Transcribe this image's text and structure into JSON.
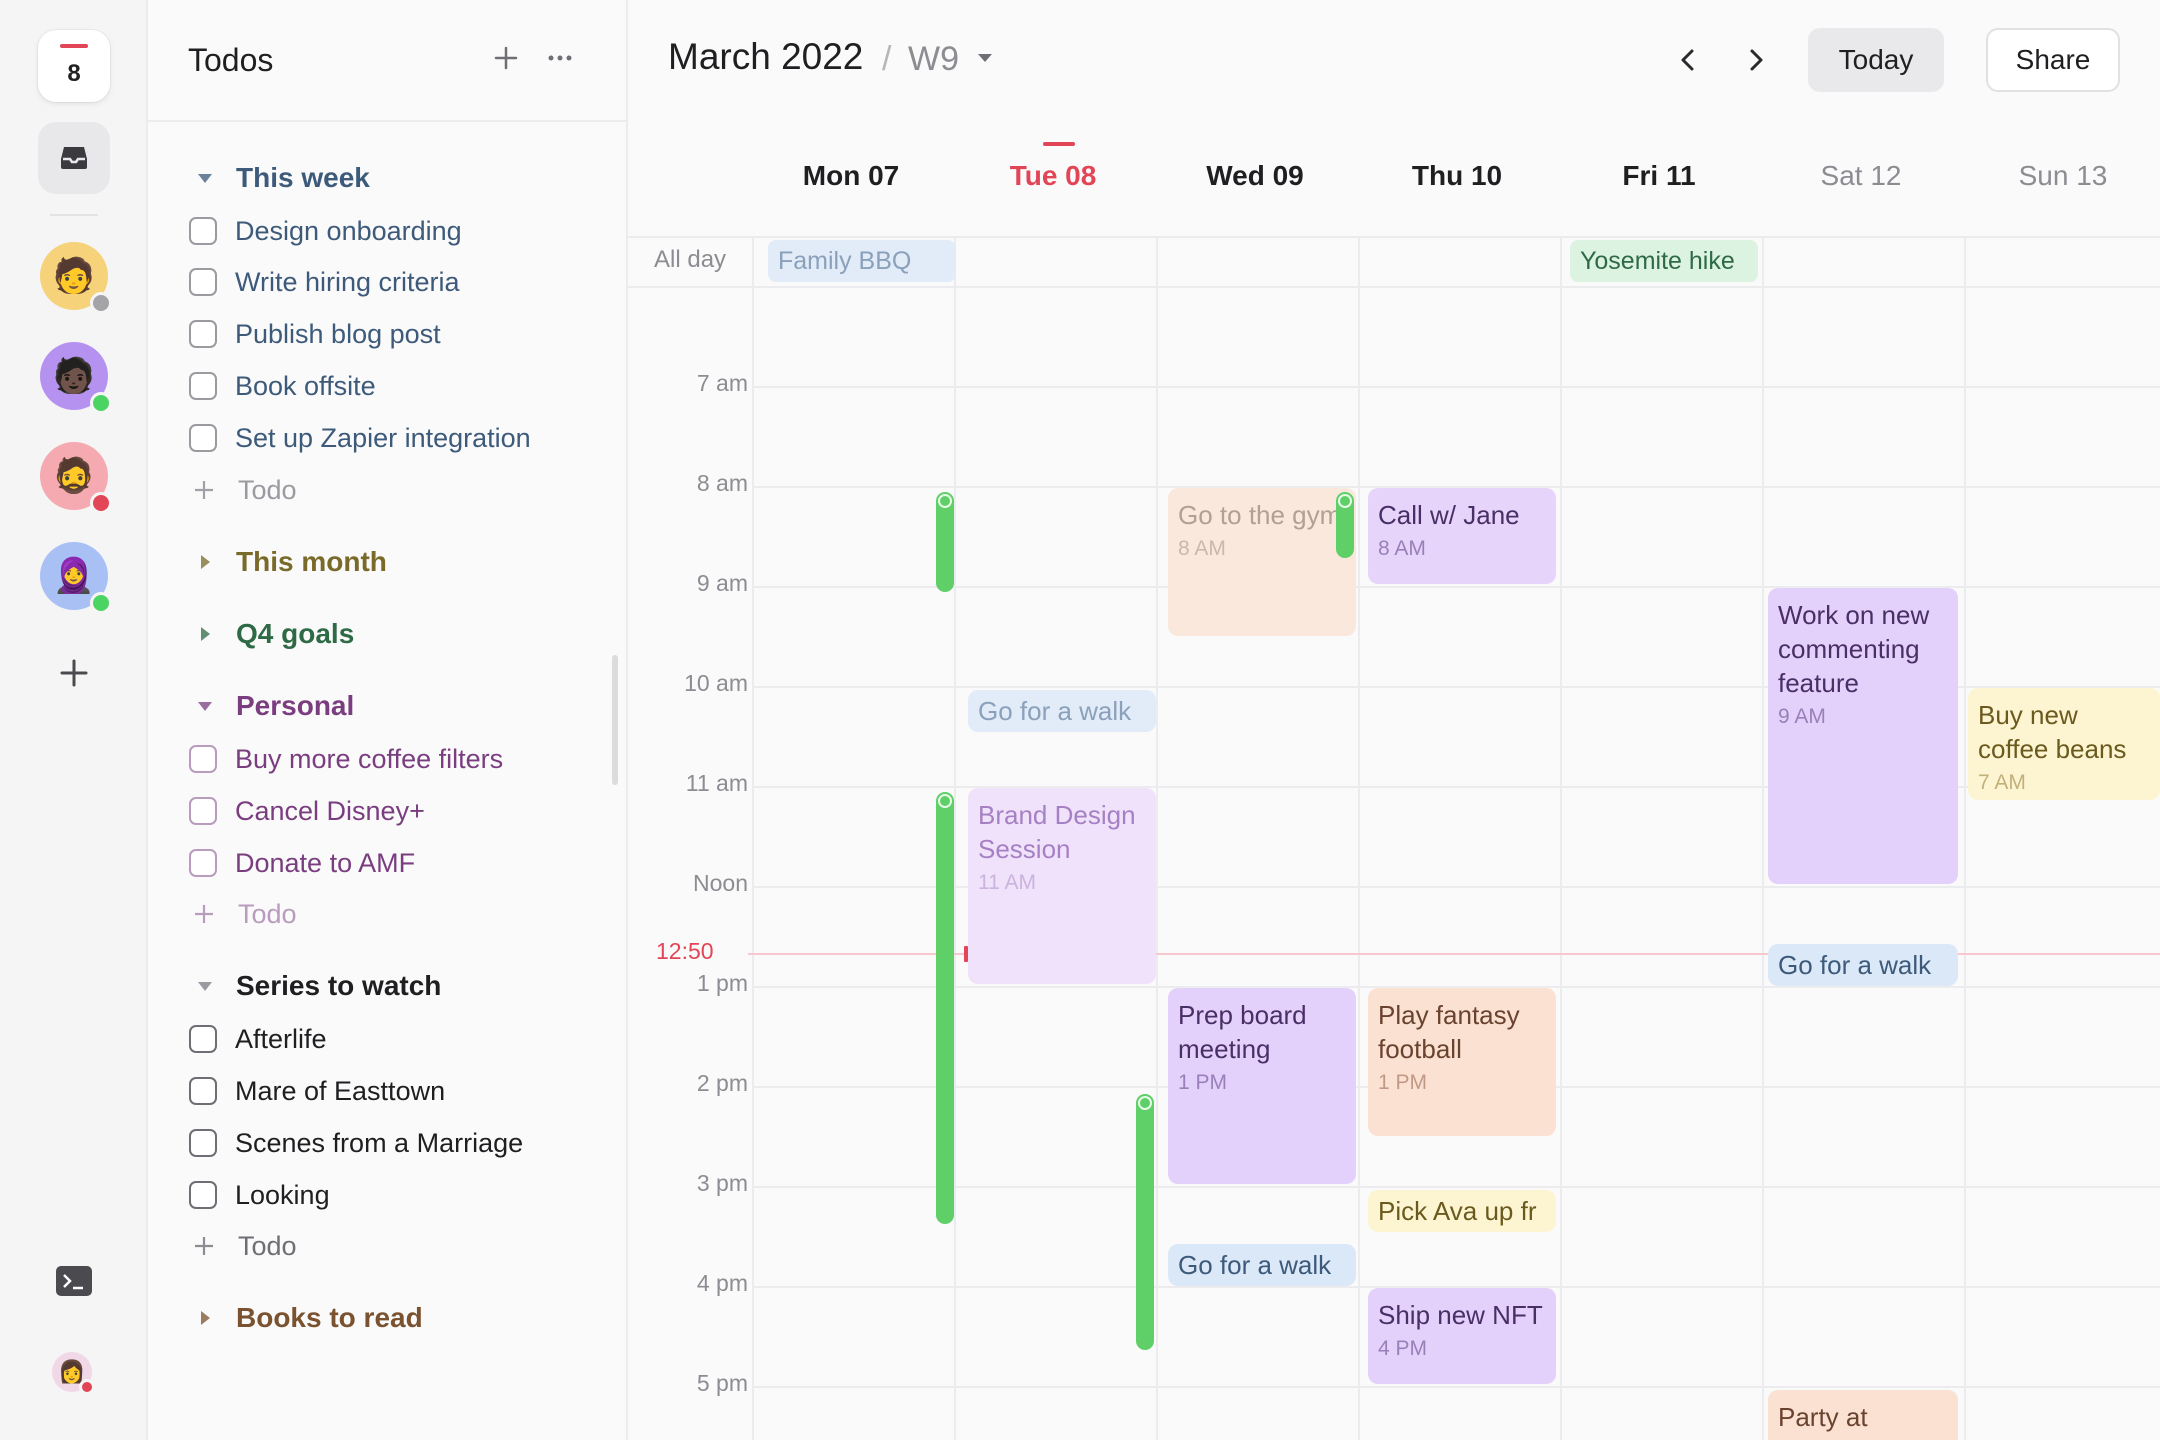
{
  "rail": {
    "date_number": "8",
    "avatars": [
      {
        "name": "avatar-1",
        "status_color": "#a3a3a8",
        "bg": "#f6d37a",
        "emoji": "🧑"
      },
      {
        "name": "avatar-2",
        "status_color": "#4cd463",
        "bg": "#b592f0",
        "emoji": "🧑🏿"
      },
      {
        "name": "avatar-3",
        "status_color": "#e24556",
        "bg": "#f4aab0",
        "emoji": "🧔"
      },
      {
        "name": "avatar-4",
        "status_color": "#4cd463",
        "bg": "#a9c0f5",
        "emoji": "🧕"
      }
    ]
  },
  "sidebar": {
    "title": "Todos",
    "sections": [
      {
        "label": "This week",
        "color": "#3d5a7a",
        "expanded": true,
        "items": [
          "Design onboarding",
          "Write hiring criteria",
          "Publish blog post",
          "Book offsite",
          "Set up Zapier integration"
        ],
        "add_label": "Todo"
      },
      {
        "label": "This month",
        "color": "#7a6a2a",
        "expanded": false
      },
      {
        "label": "Q4 goals",
        "color": "#2f6a46",
        "expanded": false
      },
      {
        "label": "Personal",
        "color": "#7a3d80",
        "expanded": true,
        "items": [
          "Buy more coffee filters",
          "Cancel Disney+",
          "Donate to AMF"
        ],
        "add_label": "Todo"
      },
      {
        "label": "Series to watch",
        "color": "#1f1f22",
        "expanded": true,
        "items": [
          "Afterlife",
          "Mare of Easttown",
          "Scenes from a Marriage",
          "Looking"
        ],
        "add_label": "Todo"
      },
      {
        "label": "Books to read",
        "color": "#7a5230",
        "expanded": false
      }
    ]
  },
  "calendar": {
    "month": "March 2022",
    "separator": "/",
    "week": "W9",
    "today_label": "Today",
    "share_label": "Share",
    "allday_label": "All day",
    "days": [
      {
        "label": "Mon 07",
        "kind": "normal"
      },
      {
        "label": "Tue 08",
        "kind": "today"
      },
      {
        "label": "Wed 09",
        "kind": "normal"
      },
      {
        "label": "Thu 10",
        "kind": "normal"
      },
      {
        "label": "Fri 11",
        "kind": "normal"
      },
      {
        "label": "Sat 12",
        "kind": "weekend"
      },
      {
        "label": "Sun 13",
        "kind": "weekend"
      }
    ],
    "hours": [
      "7 am",
      "8 am",
      "9 am",
      "10 am",
      "11 am",
      "Noon",
      "1 pm",
      "2 pm",
      "3 pm",
      "4 pm",
      "5 pm"
    ],
    "now_label": "12:50",
    "allday_events": [
      {
        "title": "Family BBQ",
        "day": 0
      },
      {
        "title": "Yosemite hike",
        "day": 4
      }
    ],
    "events": {
      "go_to_gym": {
        "title": "Go to the gym",
        "time": "8 AM"
      },
      "call_jane": {
        "title": "Call w/ Jane",
        "time": "8 AM"
      },
      "commenting": {
        "title": "Work on new commenting feature",
        "time": "9 AM"
      },
      "walk_tue": {
        "title": "Go for a walk"
      },
      "coffee_beans": {
        "title": "Buy new coffee beans",
        "time": "7 AM"
      },
      "brand_design": {
        "title": "Brand Design Session",
        "time": "11 AM"
      },
      "walk_sat": {
        "title": "Go for a walk"
      },
      "prep_board": {
        "title": "Prep board meeting",
        "time": "1 PM"
      },
      "fantasy": {
        "title": "Play fantasy football",
        "time": "1 PM"
      },
      "pick_ava": {
        "title": "Pick Ava up fr"
      },
      "walk_wed": {
        "title": "Go for a walk"
      },
      "ship_nft": {
        "title": "Ship new NFT",
        "time": "4 PM"
      },
      "party": {
        "title": "Party at"
      }
    }
  }
}
